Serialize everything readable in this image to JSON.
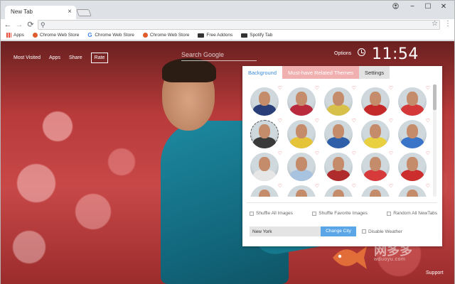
{
  "browser": {
    "tab_title": "New Tab",
    "close_glyph": "×",
    "window_controls": [
      "−",
      "☐",
      "✕"
    ],
    "profile_icon": "account-icon",
    "nav": {
      "back": "←",
      "forward": "→",
      "reload": "⟳",
      "search_glyph": "⚲",
      "star": "☆",
      "menu": "⋮"
    }
  },
  "bookmarks": [
    {
      "label": "Apps",
      "icon": "apps-grid-icon",
      "color": "#e84b3c"
    },
    {
      "label": "Chrome Web Store",
      "icon": "chrome-store-icon",
      "color": "#e05a2b"
    },
    {
      "label": "Chrome Web Store",
      "icon": "google-g-icon",
      "color": "#4285f4"
    },
    {
      "label": "Chrome Web Store",
      "icon": "chrome-store-icon",
      "color": "#e05a2b"
    },
    {
      "label": "Free Addons",
      "icon": "addons-icon",
      "color": "#333333"
    },
    {
      "label": "Spotify Tab",
      "icon": "spotify-icon",
      "color": "#333333"
    }
  ],
  "newtab": {
    "nav": [
      "Most Visited",
      "Apps",
      "Share"
    ],
    "rate": "Rate",
    "search_placeholder": "Search Google",
    "options": "Options",
    "time": "11:54",
    "support": "Support"
  },
  "panel": {
    "tabs": [
      "Background",
      "Must-have Related Themes",
      "Settings"
    ],
    "thumb_count": 25,
    "thumb_colors": [
      "#2a3f7a",
      "#b92a3c",
      "#d7c14a",
      "#c42a2a",
      "#d43838",
      "#3a3a3a",
      "#e6c43a",
      "#2f5fa8",
      "#e8d040",
      "#3a74c8",
      "#e6e6e6",
      "#a7c3e0",
      "#b02b2b",
      "#d63a3a",
      "#cc2e2e",
      "#ffffff",
      "#3f7fc8",
      "#c22828",
      "#bcd2e6",
      "#c73030",
      "#7aa7d6",
      "#d8d8d8",
      "#c42c2c",
      "#e3c34c",
      "#cf3434"
    ],
    "checkboxes": [
      "Shuffle All Images",
      "Shuffle Favorite Images",
      "Random All NewTabs"
    ],
    "city": "New York",
    "change_city": "Change City",
    "disable_weather": "Disable Weather"
  },
  "watermark": {
    "text": "网多多",
    "url": "wduoyu.com"
  }
}
